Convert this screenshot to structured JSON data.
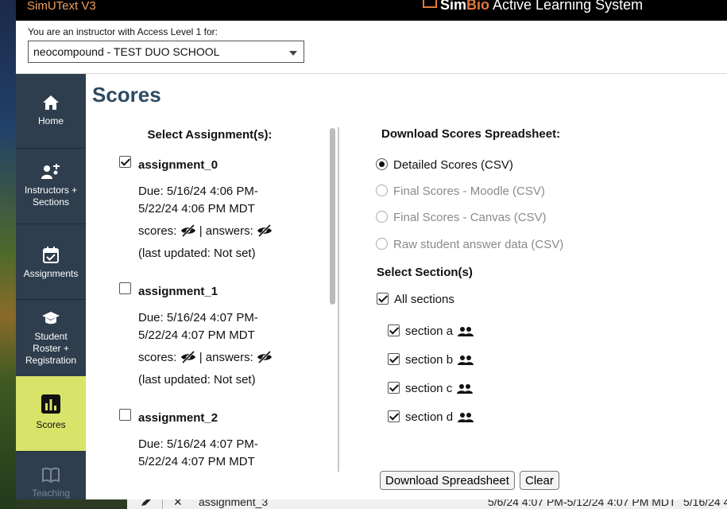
{
  "window": {
    "app_title": "SimUText V3",
    "brand_sim": "Sim",
    "brand_bio": "Bio",
    "brand_rest": " Active Learning System"
  },
  "access": {
    "label": "You are an instructor with Access Level 1 for:",
    "selected": "neocompound - TEST DUO SCHOOL"
  },
  "sidebar": {
    "items": [
      {
        "label": "Home",
        "icon": "home-icon"
      },
      {
        "label": "Instructors + Sections",
        "icon": "instructors-icon"
      },
      {
        "label": "Assignments",
        "icon": "calendar-check-icon"
      },
      {
        "label": "Student Roster + Registration",
        "icon": "graduation-cap-icon"
      },
      {
        "label": "Scores",
        "icon": "bar-chart-icon",
        "active": true
      },
      {
        "label": "Teaching",
        "icon": "book-icon"
      }
    ]
  },
  "page": {
    "title": "Scores"
  },
  "assignments": {
    "heading": "Select Assignment(s):",
    "scores_label": "scores:",
    "answers_label": "| answers:",
    "items": [
      {
        "name": "assignment_0",
        "checked": true,
        "due1": "Due: 5/16/24 4:06 PM-",
        "due2": "5/22/24 4:06 PM MDT",
        "updated": "(last updated: Not set)"
      },
      {
        "name": "assignment_1",
        "checked": false,
        "due1": "Due: 5/16/24 4:07 PM-",
        "due2": "5/22/24 4:07 PM MDT",
        "updated": "(last updated: Not set)"
      },
      {
        "name": "assignment_2",
        "checked": false,
        "due1": "Due: 5/16/24 4:07 PM-",
        "due2": "5/22/24 4:07 PM MDT"
      }
    ]
  },
  "download": {
    "heading": "Download Scores Spreadsheet:",
    "options": [
      {
        "label": "Detailed Scores (CSV)",
        "selected": true,
        "enabled": true
      },
      {
        "label": "Final Scores - Moodle (CSV)",
        "selected": false,
        "enabled": false
      },
      {
        "label": "Final Scores - Canvas (CSV)",
        "selected": false,
        "enabled": false
      },
      {
        "label": "Raw student answer data (CSV)",
        "selected": false,
        "enabled": false
      }
    ]
  },
  "sections": {
    "heading": "Select Section(s)",
    "all_label": "All sections",
    "all_checked": true,
    "items": [
      {
        "label": "section a",
        "checked": true
      },
      {
        "label": "section b",
        "checked": true
      },
      {
        "label": "section c",
        "checked": true
      },
      {
        "label": "section d",
        "checked": true
      }
    ]
  },
  "buttons": {
    "download": "Download Spreadsheet",
    "clear": "Clear"
  },
  "background_row": {
    "name": "assignment_3",
    "dates": "5/6/24 4:07 PM-5/12/24 4:07 PM MDT",
    "extra": "5/16/24 4"
  },
  "colors": {
    "sidebar": "#2e3e4e",
    "active_nav": "#d8e36a",
    "title": "#2d4a62",
    "app_title": "#f0a060"
  }
}
